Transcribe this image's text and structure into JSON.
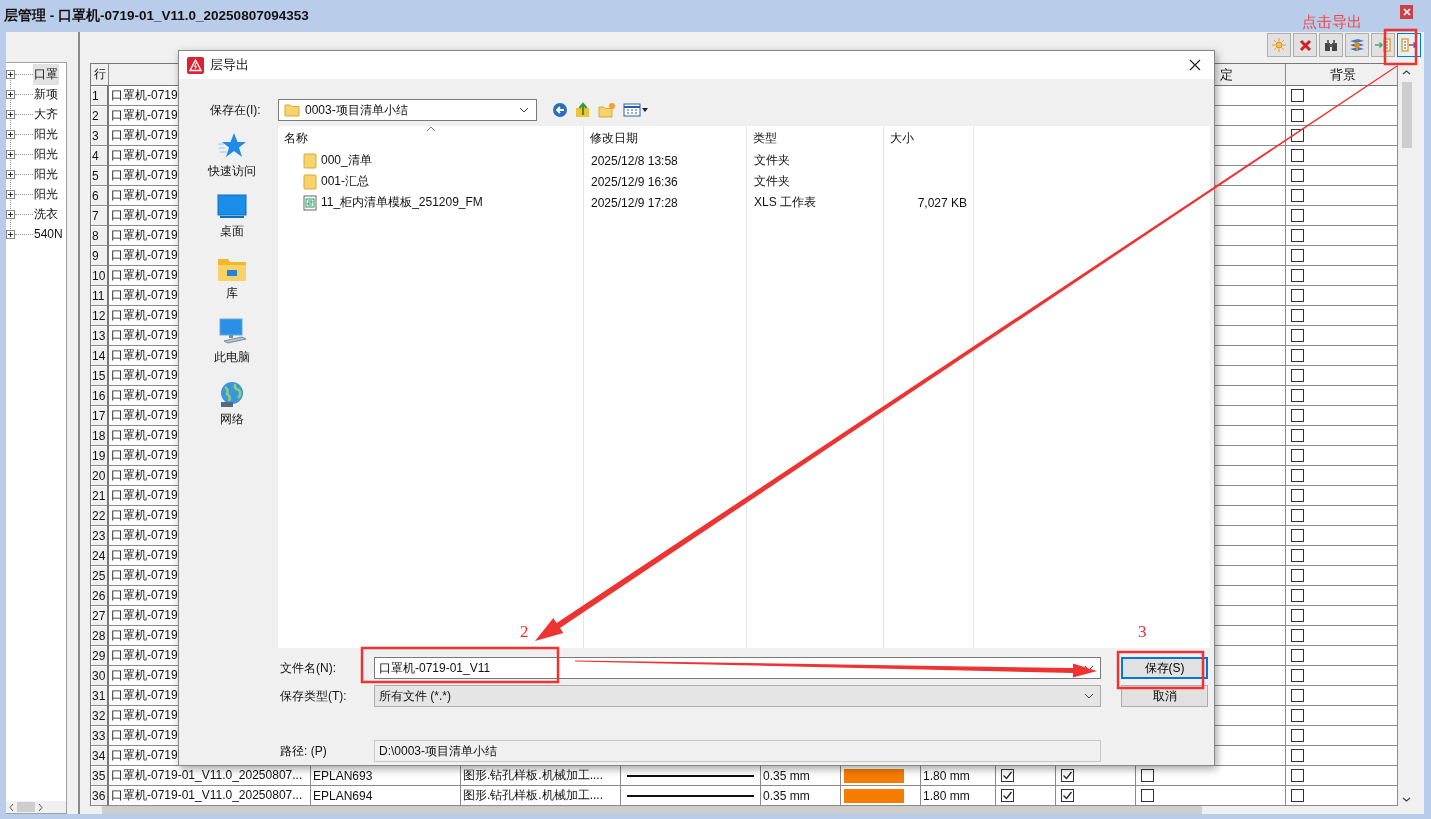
{
  "window": {
    "title": "层管理 - 口罩机-0719-01_V11.0_20250807094353"
  },
  "tree": [
    {
      "label": "口罩",
      "selected": true
    },
    {
      "label": "新项",
      "selected": false
    },
    {
      "label": "大齐",
      "selected": false
    },
    {
      "label": "阳光",
      "selected": false
    },
    {
      "label": "阳光",
      "selected": false
    },
    {
      "label": "阳光",
      "selected": false
    },
    {
      "label": "阳光",
      "selected": false
    },
    {
      "label": "洗衣",
      "selected": false
    },
    {
      "label": "540N",
      "selected": false
    }
  ],
  "toolbar": [
    {
      "kind": "sun",
      "highlighted": false
    },
    {
      "kind": "cross",
      "highlighted": false
    },
    {
      "kind": "binoculars",
      "highlighted": false
    },
    {
      "kind": "layers",
      "highlighted": false
    },
    {
      "kind": "import",
      "highlighted": false
    },
    {
      "kind": "export",
      "highlighted": true
    }
  ],
  "table": {
    "header": {
      "number": "行",
      "column_11": "定",
      "background": "背景"
    },
    "rows": [
      {
        "number": "1",
        "name": "口罩机-0719",
        "background": false
      },
      {
        "number": "2",
        "name": "口罩机-0719",
        "background": false
      },
      {
        "number": "3",
        "name": "口罩机-0719",
        "background": false
      },
      {
        "number": "4",
        "name": "口罩机-0719",
        "background": false
      },
      {
        "number": "5",
        "name": "口罩机-0719",
        "background": false
      },
      {
        "number": "6",
        "name": "口罩机-0719",
        "background": false
      },
      {
        "number": "7",
        "name": "口罩机-0719",
        "background": false
      },
      {
        "number": "8",
        "name": "口罩机-0719",
        "background": false
      },
      {
        "number": "9",
        "name": "口罩机-0719",
        "background": false
      },
      {
        "number": "10",
        "name": "口罩机-0719",
        "background": false
      },
      {
        "number": "11",
        "name": "口罩机-0719",
        "background": false
      },
      {
        "number": "12",
        "name": "口罩机-0719",
        "background": false
      },
      {
        "number": "13",
        "name": "口罩机-0719",
        "background": false
      },
      {
        "number": "14",
        "name": "口罩机-0719",
        "background": false
      },
      {
        "number": "15",
        "name": "口罩机-0719",
        "background": false
      },
      {
        "number": "16",
        "name": "口罩机-0719",
        "background": false
      },
      {
        "number": "17",
        "name": "口罩机-0719",
        "background": false
      },
      {
        "number": "18",
        "name": "口罩机-0719",
        "background": false
      },
      {
        "number": "19",
        "name": "口罩机-0719",
        "background": false
      },
      {
        "number": "20",
        "name": "口罩机-0719",
        "background": false
      },
      {
        "number": "21",
        "name": "口罩机-0719",
        "background": false
      },
      {
        "number": "22",
        "name": "口罩机-0719",
        "background": false
      },
      {
        "number": "23",
        "name": "口罩机-0719",
        "background": false
      },
      {
        "number": "24",
        "name": "口罩机-0719",
        "background": false
      },
      {
        "number": "25",
        "name": "口罩机-0719",
        "background": false
      },
      {
        "number": "26",
        "name": "口罩机-0719",
        "background": false
      },
      {
        "number": "27",
        "name": "口罩机-0719",
        "background": false
      },
      {
        "number": "28",
        "name": "口罩机-0719",
        "background": false
      },
      {
        "number": "29",
        "name": "口罩机-0719",
        "background": false
      },
      {
        "number": "30",
        "name": "口罩机-0719",
        "background": false
      },
      {
        "number": "31",
        "name": "口罩机-0719",
        "background": false
      },
      {
        "number": "32",
        "name": "口罩机-0719",
        "background": false
      },
      {
        "number": "33",
        "name": "口罩机-0719",
        "background": false
      },
      {
        "number": "34",
        "name": "口罩机-0719",
        "background": false
      },
      {
        "number": "35",
        "name": "口罩机-0719-01_V11.0_20250807...",
        "column_3": "EPLAN693",
        "column_4": "图形.钻孔样板.机械加工....",
        "column_6": "0.35 mm",
        "color": "#f57c00",
        "column_8": "1.80 mm",
        "column_9": true,
        "column_10": true,
        "column_11": false,
        "background": false
      },
      {
        "number": "36",
        "name": "口罩机-0719-01_V11.0_20250807...",
        "column_3": "EPLAN694",
        "column_4": "图形.钻孔样板.机械加工....",
        "column_6": "0.35 mm",
        "color": "#f57c00",
        "column_8": "1.80 mm",
        "column_9": true,
        "column_10": true,
        "column_11": false,
        "background": false
      }
    ]
  },
  "dialog": {
    "title": "层导出",
    "save_in_label": "保存在(I):",
    "save_in": "0003-项目清单小结",
    "places": [
      {
        "kind": "star",
        "label": "快速访问"
      },
      {
        "kind": "desktop",
        "label": "桌面"
      },
      {
        "kind": "library",
        "label": "库"
      },
      {
        "kind": "computer",
        "label": "此电脑"
      },
      {
        "kind": "network",
        "label": "网络"
      }
    ],
    "file_columns": [
      "名称",
      "修改日期",
      "类型",
      "大小"
    ],
    "files": [
      {
        "kind": "folder",
        "name": "000_清单",
        "modified": "2025/12/8 13:58",
        "type": "文件夹"
      },
      {
        "kind": "folder",
        "name": "001-汇总",
        "modified": "2025/12/9 16:36",
        "type": "文件夹"
      },
      {
        "kind": "sheet",
        "name": "11_柜内清单模板_251209_FM",
        "modified": "2025/12/9 17:28",
        "type": "XLS 工作表",
        "size": "7,027 KB"
      }
    ],
    "file_name_label": "文件名(N):",
    "file_name": "口罩机-0719-01_V11",
    "file_type_label": "保存类型(T):",
    "file_type": "所有文件 (*.*)",
    "save_button": "保存(S)",
    "cancel_button": "取消",
    "path_label": "路径: (P)",
    "path": "D:\\0003-项目清单小结"
  },
  "annotations": {
    "callout": "点击导出",
    "step_2": "2",
    "step_3": "3"
  }
}
